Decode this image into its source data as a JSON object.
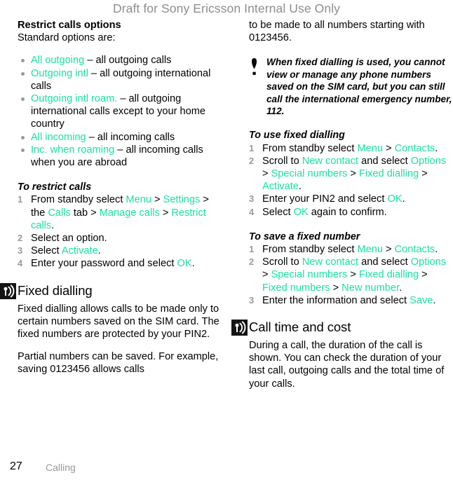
{
  "banner": {
    "text": "Draft for Sony Ericsson Internal Use Only"
  },
  "left_column": {
    "restrict_heading": "Restrict calls options",
    "restrict_intro": "Standard options are:",
    "options": [
      {
        "term": "All outgoing",
        "desc": " – all outgoing calls"
      },
      {
        "term": "Outgoing intl",
        "desc": " – all outgoing international calls"
      },
      {
        "term": "Outgoing intl roam.",
        "desc": " – all outgoing international calls except to your home country"
      },
      {
        "term": "All incoming",
        "desc": " – all incoming calls"
      },
      {
        "term": "Inc. when roaming",
        "desc": " – all incoming calls when you are abroad"
      }
    ],
    "to_restrict_heading": "To restrict calls",
    "restrict_steps": [
      {
        "parts": [
          {
            "t": "From standby select ",
            "c": "black"
          },
          {
            "t": "Menu",
            "c": "accent"
          },
          {
            "t": " > ",
            "c": "black"
          },
          {
            "t": "Settings",
            "c": "accent"
          },
          {
            "t": " > the ",
            "c": "black"
          },
          {
            "t": "Calls",
            "c": "accent"
          },
          {
            "t": " tab > ",
            "c": "black"
          },
          {
            "t": "Manage calls",
            "c": "accent"
          },
          {
            "t": " > ",
            "c": "black"
          },
          {
            "t": "Restrict calls",
            "c": "accent"
          },
          {
            "t": ".",
            "c": "black"
          }
        ]
      },
      {
        "parts": [
          {
            "t": "Select an option.",
            "c": "black"
          }
        ]
      },
      {
        "parts": [
          {
            "t": "Select ",
            "c": "black"
          },
          {
            "t": "Activate",
            "c": "accent"
          },
          {
            "t": ".",
            "c": "black"
          }
        ]
      },
      {
        "parts": [
          {
            "t": "Enter your password and select ",
            "c": "black"
          },
          {
            "t": "OK",
            "c": "accent"
          },
          {
            "t": ".",
            "c": "black"
          }
        ]
      }
    ],
    "fixed_dialling_title": "Fixed dialling",
    "fixed_dialling_icon": "broadcast-antenna-icon",
    "fixed_dialling_p1": "Fixed dialling allows calls to be made only to certain numbers saved on the SIM card. The fixed numbers are protected by your PIN2.",
    "fixed_dialling_p2": "Partial numbers can be saved. For example, saving 0123456 allows calls"
  },
  "right_column": {
    "continuation": "to be made to all numbers starting with 0123456.",
    "note_icon": "exclamation-icon",
    "note_text": "When fixed dialling is used, you cannot view or manage any phone numbers saved on the SIM card, but you can still call the international emergency number, 112.",
    "to_use_heading": "To use fixed dialling",
    "use_steps": [
      {
        "parts": [
          {
            "t": "From standby select ",
            "c": "black"
          },
          {
            "t": "Menu",
            "c": "accent"
          },
          {
            "t": " > ",
            "c": "black"
          },
          {
            "t": "Contacts",
            "c": "accent"
          },
          {
            "t": ".",
            "c": "black"
          }
        ]
      },
      {
        "parts": [
          {
            "t": "Scroll to ",
            "c": "black"
          },
          {
            "t": "New contact",
            "c": "accent"
          },
          {
            "t": " and select ",
            "c": "black"
          },
          {
            "t": "Options",
            "c": "accent"
          },
          {
            "t": " > ",
            "c": "black"
          },
          {
            "t": "Special numbers",
            "c": "accent"
          },
          {
            "t": " > ",
            "c": "black"
          },
          {
            "t": "Fixed dialling",
            "c": "accent"
          },
          {
            "t": " > ",
            "c": "black"
          },
          {
            "t": "Activate",
            "c": "accent"
          },
          {
            "t": ".",
            "c": "black"
          }
        ]
      },
      {
        "parts": [
          {
            "t": "Enter your PIN2 and select ",
            "c": "black"
          },
          {
            "t": "OK",
            "c": "accent"
          },
          {
            "t": ".",
            "c": "black"
          }
        ]
      },
      {
        "parts": [
          {
            "t": "Select ",
            "c": "black"
          },
          {
            "t": "OK",
            "c": "accent"
          },
          {
            "t": " again to confirm.",
            "c": "black"
          }
        ]
      }
    ],
    "to_save_heading": "To save a fixed number",
    "save_steps": [
      {
        "parts": [
          {
            "t": "From standby select ",
            "c": "black"
          },
          {
            "t": "Menu",
            "c": "accent"
          },
          {
            "t": " > ",
            "c": "black"
          },
          {
            "t": "Contacts",
            "c": "accent"
          },
          {
            "t": ".",
            "c": "black"
          }
        ]
      },
      {
        "parts": [
          {
            "t": "Scroll to ",
            "c": "black"
          },
          {
            "t": "New contact",
            "c": "accent"
          },
          {
            "t": " and select ",
            "c": "black"
          },
          {
            "t": "Options",
            "c": "accent"
          },
          {
            "t": " > ",
            "c": "black"
          },
          {
            "t": "Special numbers",
            "c": "accent"
          },
          {
            "t": " > ",
            "c": "black"
          },
          {
            "t": "Fixed dialling",
            "c": "accent"
          },
          {
            "t": " > ",
            "c": "black"
          },
          {
            "t": "Fixed numbers",
            "c": "accent"
          },
          {
            "t": " > ",
            "c": "black"
          },
          {
            "t": "New number",
            "c": "accent"
          },
          {
            "t": ".",
            "c": "black"
          }
        ]
      },
      {
        "parts": [
          {
            "t": "Enter the information and select ",
            "c": "black"
          },
          {
            "t": "Save",
            "c": "accent"
          },
          {
            "t": ".",
            "c": "black"
          }
        ]
      }
    ],
    "call_time_title": "Call time and cost",
    "call_time_icon": "broadcast-antenna-icon",
    "call_time_p1": "During a call, the duration of the call is shown. You can check the duration of your last call, outgoing calls and the total time of your calls."
  },
  "footer": {
    "page_number": "27",
    "chapter": "Calling"
  },
  "colors": {
    "accent": "#19e2a0",
    "muted": "#9a9a9a",
    "banner": "#8d8d8d",
    "text": "#000000"
  }
}
